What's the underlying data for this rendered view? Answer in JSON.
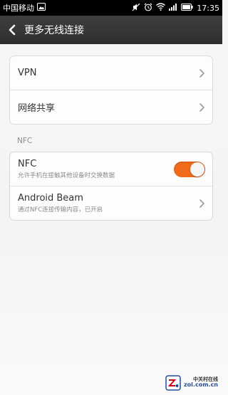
{
  "status_bar": {
    "carrier": "中国移动",
    "time": "17:35",
    "icons": [
      "image-icon",
      "mute-icon",
      "alarm-icon",
      "wifi-icon",
      "signal-icon",
      "battery-icon"
    ]
  },
  "title_bar": {
    "back_icon": "chevron-left-icon",
    "title": "更多无线连接"
  },
  "group1": {
    "items": [
      {
        "label": "VPN"
      },
      {
        "label": "网络共享"
      }
    ]
  },
  "nfc_section": {
    "header": "NFC",
    "nfc": {
      "label": "NFC",
      "sub": "允许手机在接触其他设备时交换数据",
      "enabled": true
    },
    "beam": {
      "label": "Android Beam",
      "sub": "通过NFC连接传输内容，已开启"
    }
  },
  "colors": {
    "accent": "#f06b1c",
    "title_bar": "#333333"
  },
  "watermark": {
    "name": "中关村在线",
    "url": "zol.com.cn"
  }
}
